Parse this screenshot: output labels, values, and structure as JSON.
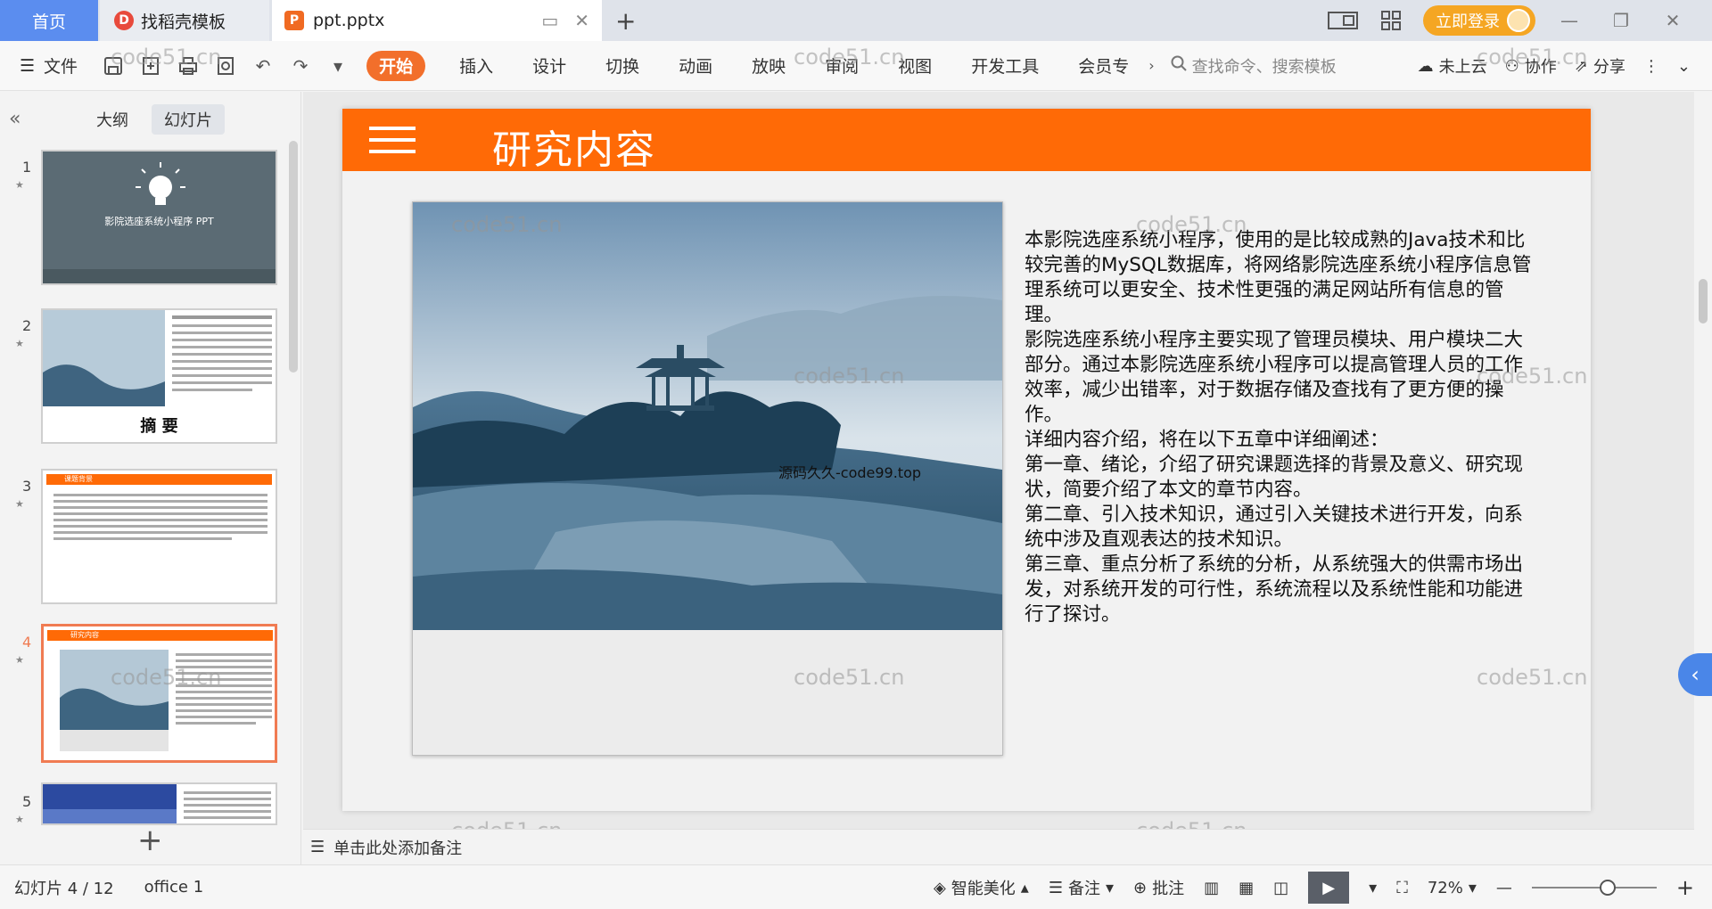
{
  "tabs": {
    "home": "首页",
    "template": "找稻壳模板",
    "document": "ppt.pptx"
  },
  "title_right": {
    "login": "立即登录"
  },
  "menubar": {
    "file": "文件",
    "menus": [
      "开始",
      "插入",
      "设计",
      "切换",
      "动画",
      "放映",
      "审阅",
      "视图",
      "开发工具",
      "会员专"
    ],
    "search_placeholder": "查找命令、搜索模板",
    "cloud": "未上云",
    "collab": "协作",
    "share": "分享"
  },
  "left_panel": {
    "tab_outline": "大纲",
    "tab_slides": "幻灯片",
    "thumbnails": [
      {
        "num": "1",
        "title": "影院选座系统小程序 PPT"
      },
      {
        "num": "2",
        "title": "摘  要"
      },
      {
        "num": "3",
        "title": "课题背景"
      },
      {
        "num": "4",
        "title": "研究内容"
      },
      {
        "num": "5",
        "title": ""
      }
    ]
  },
  "slide": {
    "title": "研究内容",
    "photo_caption": "源码久久-code99.top",
    "paragraphs": [
      "    本影院选座系统小程序，使用的是比较成熟的Java技术和比较完善的MySQL数据库，将网络影院选座系统小程序信息管理系统可以更安全、技术性更强的满足网站所有信息的管理。",
      "影院选座系统小程序主要实现了管理员模块、用户模块二大部分。通过本影院选座系统小程序可以提高管理人员的工作效率，减少出错率，对于数据存储及查找有了更方便的操作。",
      "详细内容介绍，将在以下五章中详细阐述：",
      "第一章、绪论，介绍了研究课题选择的背景及意义、研究现状，简要介绍了本文的章节内容。",
      "第二章、引入技术知识，通过引入关键技术进行开发，向系统中涉及直观表达的技术知识。",
      "第三章、重点分析了系统的分析，从系统强大的供需市场出发，对系统开发的可行性，系统流程以及系统性能和功能进行了探讨。"
    ]
  },
  "watermark": "code51.cn",
  "notes": "单击此处添加备注",
  "statusbar": {
    "slide_info": "幻灯片 4 / 12",
    "theme": "office 1",
    "beautify": "智能美化",
    "notes_btn": "备注",
    "comment": "批注",
    "zoom": "72%"
  },
  "colors": {
    "accent": "#ff6a06",
    "tab_home": "#5b8def",
    "login": "#f5a623",
    "selected_thumb_border": "#f07b52"
  }
}
